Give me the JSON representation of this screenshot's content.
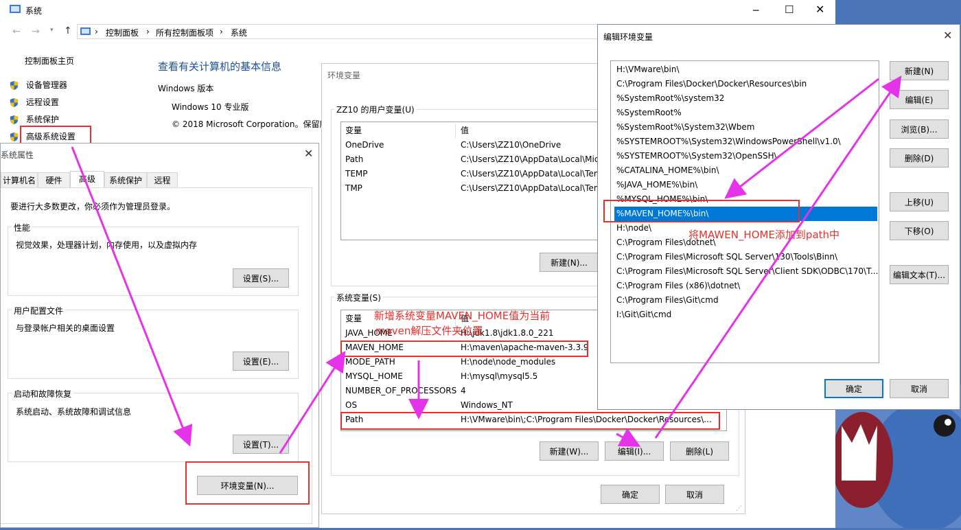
{
  "system_window": {
    "title": "系统",
    "breadcrumb": [
      "控制面板",
      "所有控制面板项",
      "系统"
    ],
    "sidebar_home": "控制面板主页",
    "sidebar_items": [
      "设备管理器",
      "远程设置",
      "系统保护",
      "高级系统设置"
    ],
    "heading": "查看有关计算机的基本信息",
    "section": "Windows 版本",
    "edition": "Windows 10 专业版",
    "copyright": "© 2018 Microsoft Corporation。保留所"
  },
  "sysprops": {
    "title": "系统属性",
    "tabs": [
      "计算机名",
      "硬件",
      "高级",
      "系统保护",
      "远程"
    ],
    "active_tab": "高级",
    "admin_note": "要进行大多数更改，你必须作为管理员登录。",
    "perf": {
      "label": "性能",
      "desc": "视觉效果，处理器计划，内存使用，以及虚拟内存",
      "btn": "设置(S)..."
    },
    "profile": {
      "label": "用户配置文件",
      "desc": "与登录帐户相关的桌面设置",
      "btn": "设置(E)..."
    },
    "startup": {
      "label": "启动和故障恢复",
      "desc": "系统启动、系统故障和调试信息",
      "btn": "设置(T)..."
    },
    "env_btn": "环境变量(N)..."
  },
  "envvars": {
    "title": "环境变量",
    "user_group": "ZZ10 的用户变量(U)",
    "col_var": "变量",
    "col_val": "值",
    "user_vars": [
      {
        "name": "OneDrive",
        "value": "C:\\Users\\ZZ10\\OneDrive"
      },
      {
        "name": "Path",
        "value": "C:\\Users\\ZZ10\\AppData\\Local\\Mic"
      },
      {
        "name": "TEMP",
        "value": "C:\\Users\\ZZ10\\AppData\\Local\\Tem"
      },
      {
        "name": "TMP",
        "value": "C:\\Users\\ZZ10\\AppData\\Local\\Tem"
      }
    ],
    "user_new_btn": "新建(N)...",
    "sys_group": "系统变量(S)",
    "sys_vars": [
      {
        "name": "JAVA_HOME",
        "value": "H:\\jdk1.8\\jdk1.8.0_221"
      },
      {
        "name": "MAVEN_HOME",
        "value": "H:\\maven\\apache-maven-3.3.9"
      },
      {
        "name": "MODE_PATH",
        "value": "H:\\node\\node_modules"
      },
      {
        "name": "MYSQL_HOME",
        "value": "H:\\mysql\\mysql5.5"
      },
      {
        "name": "NUMBER_OF_PROCESSORS",
        "value": "4"
      },
      {
        "name": "OS",
        "value": "Windows_NT"
      },
      {
        "name": "Path",
        "value": "H:\\VMware\\bin\\;C:\\Program Files\\Docker\\Docker\\Resources\\..."
      }
    ],
    "sys_new_btn": "新建(W)...",
    "sys_edit_btn": "编辑(I)...",
    "sys_del_btn": "删除(L)",
    "ok_btn": "确定",
    "cancel_btn": "取消"
  },
  "editenv": {
    "title": "编辑环境变量",
    "paths": [
      "H:\\VMware\\bin\\",
      "C:\\Program Files\\Docker\\Docker\\Resources\\bin",
      "%SystemRoot%\\system32",
      "%SystemRoot%",
      "%SystemRoot%\\System32\\Wbem",
      "%SYSTEMROOT%\\System32\\WindowsPowerShell\\v1.0\\",
      "%SYSTEMROOT%\\System32\\OpenSSH\\",
      "%CATALINA_HOME%\\bin\\",
      "%JAVA_HOME%\\bin\\",
      "%MYSQL_HOME%\\bin\\",
      "%MAVEN_HOME%\\bin\\",
      "H:\\node\\",
      "C:\\Program Files\\dotnet\\",
      "C:\\Program Files\\Microsoft SQL Server\\130\\Tools\\Binn\\",
      "C:\\Program Files\\Microsoft SQL Server\\Client SDK\\ODBC\\170\\T...",
      "C:\\Program Files (x86)\\dotnet\\",
      "C:\\Program Files\\Git\\cmd",
      "I:\\Git\\Git\\cmd"
    ],
    "selected_index": 10,
    "btn_new": "新建(N)",
    "btn_edit": "编辑(E)",
    "btn_browse": "浏览(B)...",
    "btn_delete": "删除(D)",
    "btn_up": "上移(U)",
    "btn_down": "下移(O)",
    "btn_edittext": "编辑文本(T)...",
    "ok_btn": "确定",
    "cancel_btn": "取消"
  },
  "annotations": {
    "note1_line1": "新增系统变量MAVEN_HOME值为当前",
    "note1_line2": "maven解压文件夹位置",
    "note2": "将MAWEN_HOME添加到path中"
  },
  "colors": {
    "annotation_red": "#e8302b",
    "arrow_magenta": "#e433e8",
    "selection_blue": "#0078d7",
    "link_blue": "#1e4fa0"
  }
}
